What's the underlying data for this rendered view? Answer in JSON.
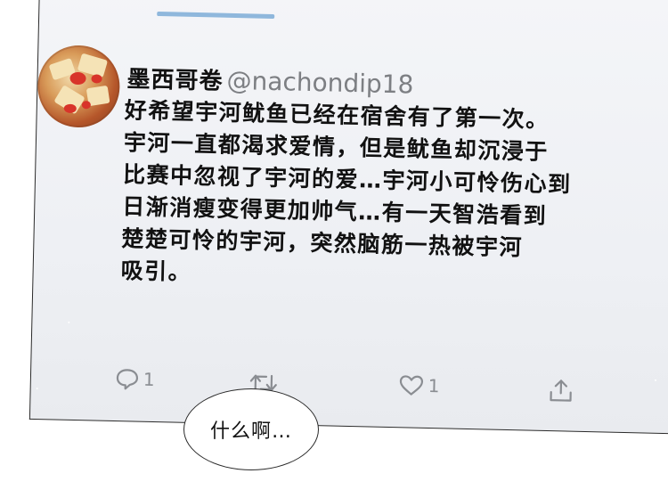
{
  "tweet": {
    "display_name": "墨西哥卷",
    "handle": "@nachondip18",
    "lines": [
      "好希望宇河鱿鱼已经在宿舍有了第一次。",
      "宇河一直都渴求爱情，但是鱿鱼却沉浸于",
      "比赛中忽视了宇河的爱…宇河小可怜伤心到",
      "日渐消瘦变得更加帅气…有一天智浩看到",
      "楚楚可怜的宇河，突然脑筋一热被宇河",
      "吸引。"
    ],
    "actions": {
      "reply_count": "1",
      "like_count": "1"
    }
  },
  "icons": {
    "reply": "speech-bubble-icon",
    "retweet": "retweet-icon",
    "like": "heart-icon",
    "share": "share-icon"
  },
  "speech_bubble": {
    "text": "什么啊…"
  },
  "colors": {
    "tab_indicator": "#8fb7dc",
    "handle": "#7d7f83",
    "action_icon": "#8a8d92"
  }
}
